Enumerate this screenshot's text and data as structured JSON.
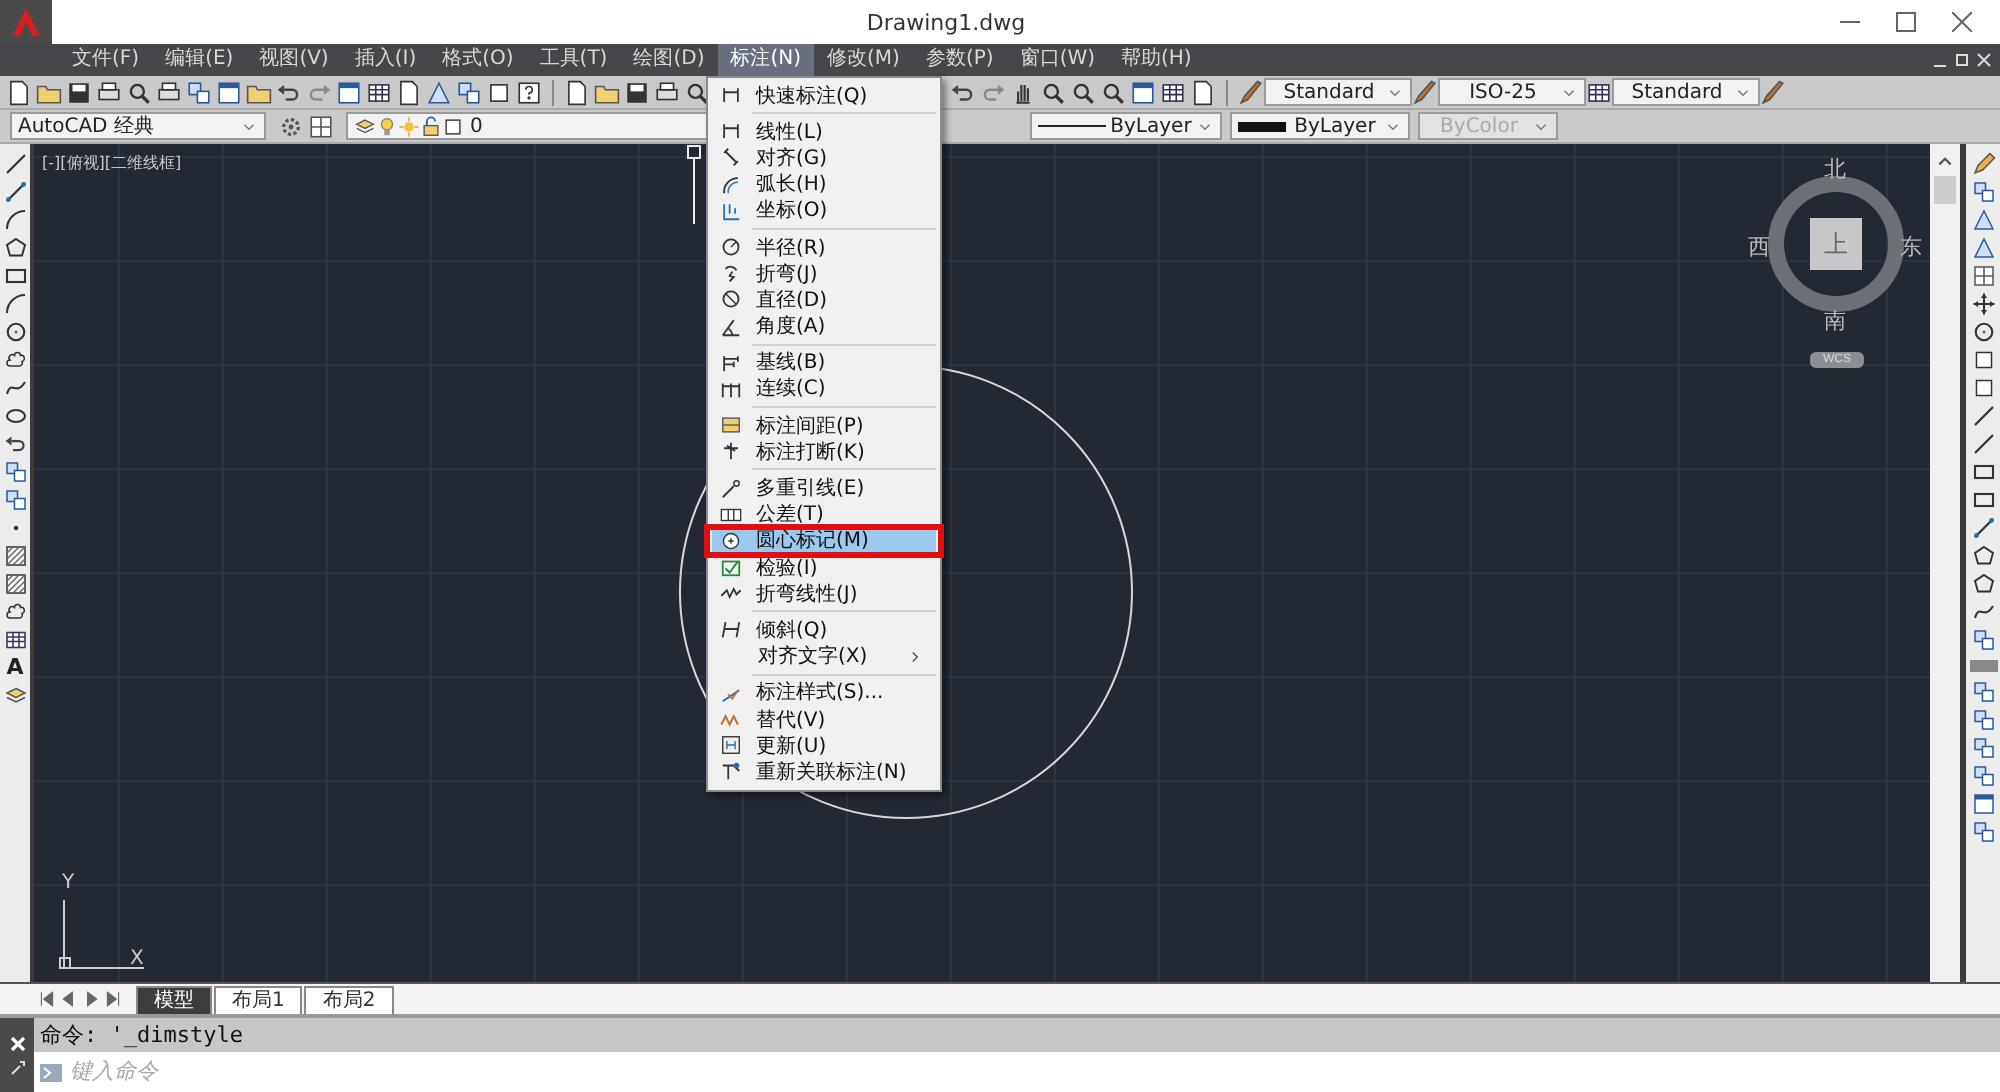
{
  "window": {
    "title": "Drawing1.dwg"
  },
  "menu_bar": [
    {
      "label": "文件(F)",
      "selected": false
    },
    {
      "label": "编辑(E)",
      "selected": false
    },
    {
      "label": "视图(V)",
      "selected": false
    },
    {
      "label": "插入(I)",
      "selected": false
    },
    {
      "label": "格式(O)",
      "selected": false
    },
    {
      "label": "工具(T)",
      "selected": false
    },
    {
      "label": "绘图(D)",
      "selected": false
    },
    {
      "label": "标注(N)",
      "selected": true
    },
    {
      "label": "修改(M)",
      "selected": false
    },
    {
      "label": "参数(P)",
      "selected": false
    },
    {
      "label": "窗口(W)",
      "selected": false
    },
    {
      "label": "帮助(H)",
      "selected": false
    }
  ],
  "styles_toolbar": {
    "text_style": "Standard",
    "dimension_style": "ISO-25",
    "table_style": "Standard"
  },
  "properties_toolbar": {
    "workspace": "AutoCAD 经典",
    "layer": "0",
    "linetype": "ByLayer",
    "lineweight": "ByLayer",
    "plot_style": {
      "value": "ByColor",
      "disabled": true
    }
  },
  "draw_toolbar": {
    "text_tool": "A"
  },
  "viewport": {
    "label": "[-][俯视][二维线框]",
    "compass": {
      "north": "北",
      "south": "南",
      "west": "西",
      "east": "东",
      "face": "上",
      "ucs": "WCS"
    },
    "ucs_icon": {
      "x": "X",
      "y": "Y"
    }
  },
  "dimension_menu": {
    "groups": [
      [
        {
          "label": "快速标注(Q)",
          "icon": true,
          "submenu": false,
          "selected": false,
          "marked": false
        }
      ],
      [
        {
          "label": "线性(L)",
          "icon": true,
          "submenu": false,
          "selected": false,
          "marked": false
        },
        {
          "label": "对齐(G)",
          "icon": true,
          "submenu": false,
          "selected": false,
          "marked": false
        },
        {
          "label": "弧长(H)",
          "icon": true,
          "submenu": false,
          "selected": false,
          "marked": false
        },
        {
          "label": "坐标(O)",
          "icon": true,
          "submenu": false,
          "selected": false,
          "marked": false
        }
      ],
      [
        {
          "label": "半径(R)",
          "icon": true,
          "submenu": false,
          "selected": false,
          "marked": false
        },
        {
          "label": "折弯(J)",
          "icon": true,
          "submenu": false,
          "selected": false,
          "marked": false
        },
        {
          "label": "直径(D)",
          "icon": true,
          "submenu": false,
          "selected": false,
          "marked": false
        },
        {
          "label": "角度(A)",
          "icon": true,
          "submenu": false,
          "selected": false,
          "marked": false
        }
      ],
      [
        {
          "label": "基线(B)",
          "icon": true,
          "submenu": false,
          "selected": false,
          "marked": false
        },
        {
          "label": "连续(C)",
          "icon": true,
          "submenu": false,
          "selected": false,
          "marked": false
        }
      ],
      [
        {
          "label": "标注间距(P)",
          "icon": true,
          "submenu": false,
          "selected": false,
          "marked": false
        },
        {
          "label": "标注打断(K)",
          "icon": true,
          "submenu": false,
          "selected": false,
          "marked": false
        }
      ],
      [
        {
          "label": "多重引线(E)",
          "icon": true,
          "submenu": false,
          "selected": false,
          "marked": false
        },
        {
          "label": "公差(T)",
          "icon": true,
          "submenu": false,
          "selected": false,
          "marked": false
        },
        {
          "label": "圆心标记(M)",
          "icon": true,
          "submenu": false,
          "selected": true,
          "marked": true
        },
        {
          "label": "检验(I)",
          "icon": true,
          "submenu": false,
          "selected": false,
          "marked": false
        },
        {
          "label": "折弯线性(J)",
          "icon": true,
          "submenu": false,
          "selected": false,
          "marked": false
        }
      ],
      [
        {
          "label": "倾斜(Q)",
          "icon": true,
          "submenu": false,
          "selected": false,
          "marked": false
        },
        {
          "label": "对齐文字(X)",
          "icon": false,
          "submenu": true,
          "selected": false,
          "marked": false
        }
      ],
      [
        {
          "label": "标注样式(S)...",
          "icon": true,
          "submenu": false,
          "selected": false,
          "marked": false
        },
        {
          "label": "替代(V)",
          "icon": true,
          "submenu": false,
          "selected": false,
          "marked": false
        },
        {
          "label": "更新(U)",
          "icon": true,
          "submenu": false,
          "selected": false,
          "marked": false
        },
        {
          "label": "重新关联标注(N)",
          "icon": true,
          "submenu": false,
          "selected": false,
          "marked": false
        }
      ]
    ]
  },
  "layout_tabs": [
    {
      "label": "模型",
      "selected": true
    },
    {
      "label": "布局1",
      "selected": false
    },
    {
      "label": "布局2",
      "selected": false
    }
  ],
  "command_line": {
    "history": "命令: '_dimstyle",
    "placeholder": "键入命令"
  }
}
